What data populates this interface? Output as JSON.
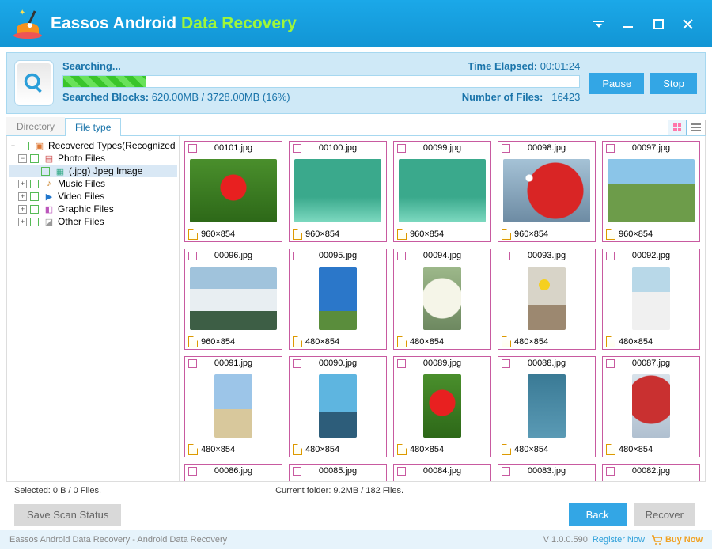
{
  "title": {
    "word1": "Eassos",
    "word2": "Android",
    "word3": "Data Recovery"
  },
  "progress": {
    "searching_label": "Searching...",
    "elapsed_label": "Time Elapsed:",
    "elapsed_value": "00:01:24",
    "bar_percent": 16,
    "blocks_label": "Searched Blocks:",
    "blocks_value": "620.00MB / 3728.00MB (16%)",
    "files_label": "Number of Files:",
    "files_value": "16423",
    "pause_label": "Pause",
    "stop_label": "Stop"
  },
  "tabs": {
    "a": "Directory",
    "b": "File type"
  },
  "tree": {
    "root": "Recovered Types(Recognized",
    "photo": "Photo Files",
    "jpeg": "(.jpg) Jpeg Image",
    "music": "Music Files",
    "video": "Video Files",
    "graphic": "Graphic Files",
    "other": "Other Files"
  },
  "files": [
    {
      "name": "00101.jpg",
      "dim": "960×854",
      "thumb": "t-redflower",
      "wide": true
    },
    {
      "name": "00100.jpg",
      "dim": "960×854",
      "thumb": "t-teal",
      "wide": true
    },
    {
      "name": "00099.jpg",
      "dim": "960×854",
      "thumb": "t-teal",
      "wide": true
    },
    {
      "name": "00098.jpg",
      "dim": "960×854",
      "thumb": "t-redleaves",
      "wide": true
    },
    {
      "name": "00097.jpg",
      "dim": "960×854",
      "thumb": "t-park",
      "wide": true
    },
    {
      "name": "00096.jpg",
      "dim": "960×854",
      "thumb": "t-snow",
      "wide": true
    },
    {
      "name": "00095.jpg",
      "dim": "480×854",
      "thumb": "t-bluesky",
      "wide": false
    },
    {
      "name": "00094.jpg",
      "dim": "480×854",
      "thumb": "t-whitetree",
      "wide": false
    },
    {
      "name": "00093.jpg",
      "dim": "480×854",
      "thumb": "t-kid",
      "wide": false
    },
    {
      "name": "00092.jpg",
      "dim": "480×854",
      "thumb": "t-snowballs",
      "wide": false
    },
    {
      "name": "00091.jpg",
      "dim": "480×854",
      "thumb": "t-beach",
      "wide": false
    },
    {
      "name": "00090.jpg",
      "dim": "480×854",
      "thumb": "t-bluemtn",
      "wide": false
    },
    {
      "name": "00089.jpg",
      "dim": "480×854",
      "thumb": "t-redflower",
      "wide": false
    },
    {
      "name": "00088.jpg",
      "dim": "480×854",
      "thumb": "t-water",
      "wide": false
    },
    {
      "name": "00087.jpg",
      "dim": "480×854",
      "thumb": "t-redtree",
      "wide": false
    },
    {
      "name": "00086.jpg",
      "dim": "",
      "thumb": "",
      "wide": false
    },
    {
      "name": "00085.jpg",
      "dim": "",
      "thumb": "",
      "wide": false
    },
    {
      "name": "00084.jpg",
      "dim": "",
      "thumb": "",
      "wide": false
    },
    {
      "name": "00083.jpg",
      "dim": "",
      "thumb": "",
      "wide": false
    },
    {
      "name": "00082.jpg",
      "dim": "",
      "thumb": "",
      "wide": false
    }
  ],
  "status": {
    "selected": "Selected: 0 B / 0 Files.",
    "current_folder": "Current folder: 9.2MB / 182 Files."
  },
  "actions": {
    "save_scan": "Save Scan Status",
    "back": "Back",
    "recover": "Recover"
  },
  "footer": {
    "product": "Eassos Android Data Recovery - Android Data Recovery",
    "version": "V 1.0.0.590",
    "register": "Register Now",
    "buy": "Buy Now"
  }
}
